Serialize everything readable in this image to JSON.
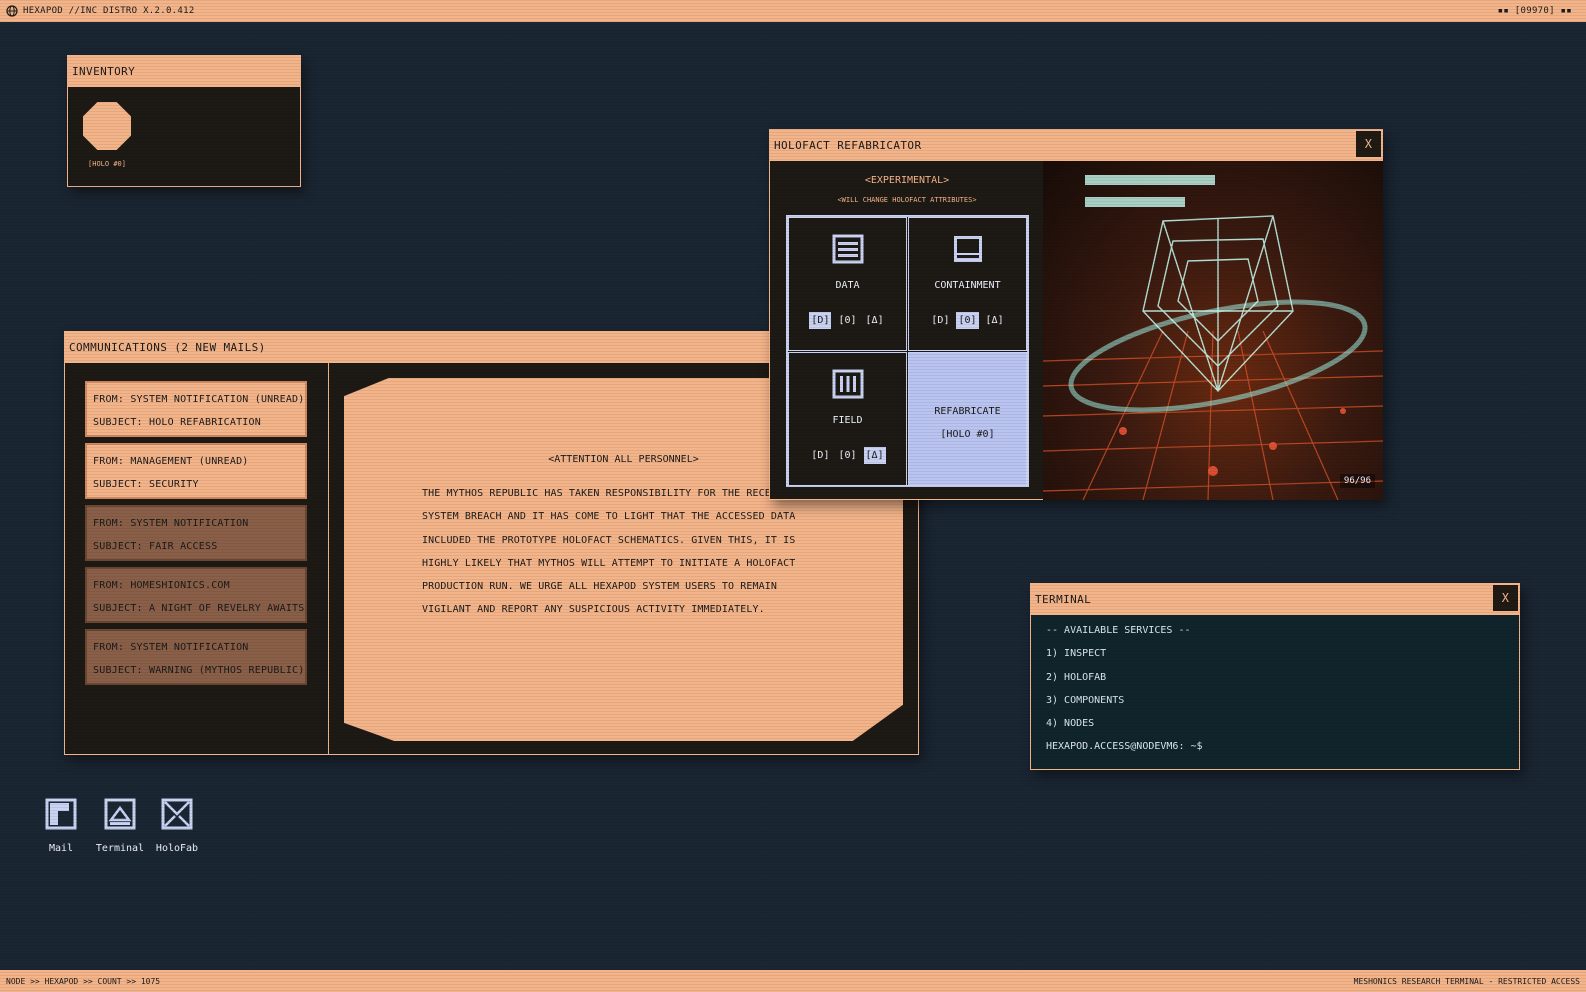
{
  "topbar": {
    "title": "HEXAPOD //INC DISTRO X.2.0.412",
    "right": "▪▪ [09970] ▪▪"
  },
  "bottombar": {
    "left": "NODE >> HEXAPOD >> COUNT >> 1075",
    "right": "MESHONICS RESEARCH TERMINAL - RESTRICTED ACCESS"
  },
  "inventory": {
    "title": "INVENTORY",
    "item_label": "[HOLO #0]"
  },
  "comms": {
    "title": "COMMUNICATIONS (2 NEW MAILS)",
    "mails": [
      {
        "from": "FROM: SYSTEM NOTIFICATION (UNREAD)",
        "subject": "SUBJECT: HOLO REFABRICATION",
        "state": "unread"
      },
      {
        "from": "FROM: MANAGEMENT (UNREAD)",
        "subject": "SUBJECT: SECURITY",
        "state": "unread"
      },
      {
        "from": "FROM: SYSTEM NOTIFICATION",
        "subject": "SUBJECT: FAIR ACCESS",
        "state": "read"
      },
      {
        "from": "FROM: HOMESHIONICS.COM",
        "subject": "SUBJECT: A NIGHT OF REVELRY AWAITS",
        "state": "read"
      },
      {
        "from": "FROM: SYSTEM NOTIFICATION",
        "subject": "SUBJECT: WARNING (MYTHOS REPUBLIC)",
        "state": "read"
      }
    ],
    "reader": {
      "heading": "<ATTENTION ALL PERSONNEL>",
      "body": "THE MYTHOS REPUBLIC HAS TAKEN RESPONSIBILITY FOR THE RECENT SYSTEM BREACH AND IT HAS COME TO LIGHT THAT THE ACCESSED DATA INCLUDED THE PROTOTYPE HOLOFACT SCHEMATICS. GIVEN THIS, IT IS HIGHLY LIKELY THAT MYTHOS WILL ATTEMPT TO INITIATE A HOLOFACT PRODUCTION RUN. WE URGE ALL HEXAPOD SYSTEM USERS TO REMAIN VIGILANT AND REPORT ANY SUSPICIOUS ACTIVITY IMMEDIATELY."
    }
  },
  "refab": {
    "title": "HOLOFACT REFABRICATOR",
    "close": "X",
    "experimental": "<EXPERIMENTAL>",
    "subtitle": "<WILL CHANGE HOLOFACT ATTRIBUTES>",
    "cells": {
      "data": {
        "label": "DATA",
        "icon": "data-icon",
        "options": [
          "[D]",
          "[0]",
          "[Δ]"
        ],
        "selected": 0
      },
      "containment": {
        "label": "CONTAINMENT",
        "icon": "containment-icon",
        "options": [
          "[D]",
          "[0]",
          "[Δ]"
        ],
        "selected": 1
      },
      "field": {
        "label": "FIELD",
        "icon": "field-icon",
        "options": [
          "[D]",
          "[0]",
          "[Δ]"
        ],
        "selected": 2
      }
    },
    "refabricate": {
      "line1": "REFABRICATE",
      "line2": "[HOLO #0]"
    },
    "preview": {
      "counter": "96/96"
    }
  },
  "terminal": {
    "title": "TERMINAL",
    "close": "X",
    "header": "-- AVAILABLE SERVICES --",
    "services": [
      "1) INSPECT",
      "2) HOLOFAB",
      "3) COMPONENTS",
      "4) NODES"
    ],
    "prompt": "HEXAPOD.ACCESS@NODEVM6: ~$"
  },
  "desktop": {
    "icons": [
      "Mail",
      "Terminal",
      "HoloFab"
    ]
  },
  "colors": {
    "accent": "#f4b48a",
    "background": "#1b2633",
    "highlight": "#c9d2f2",
    "terminal_bg": "#10242c"
  }
}
